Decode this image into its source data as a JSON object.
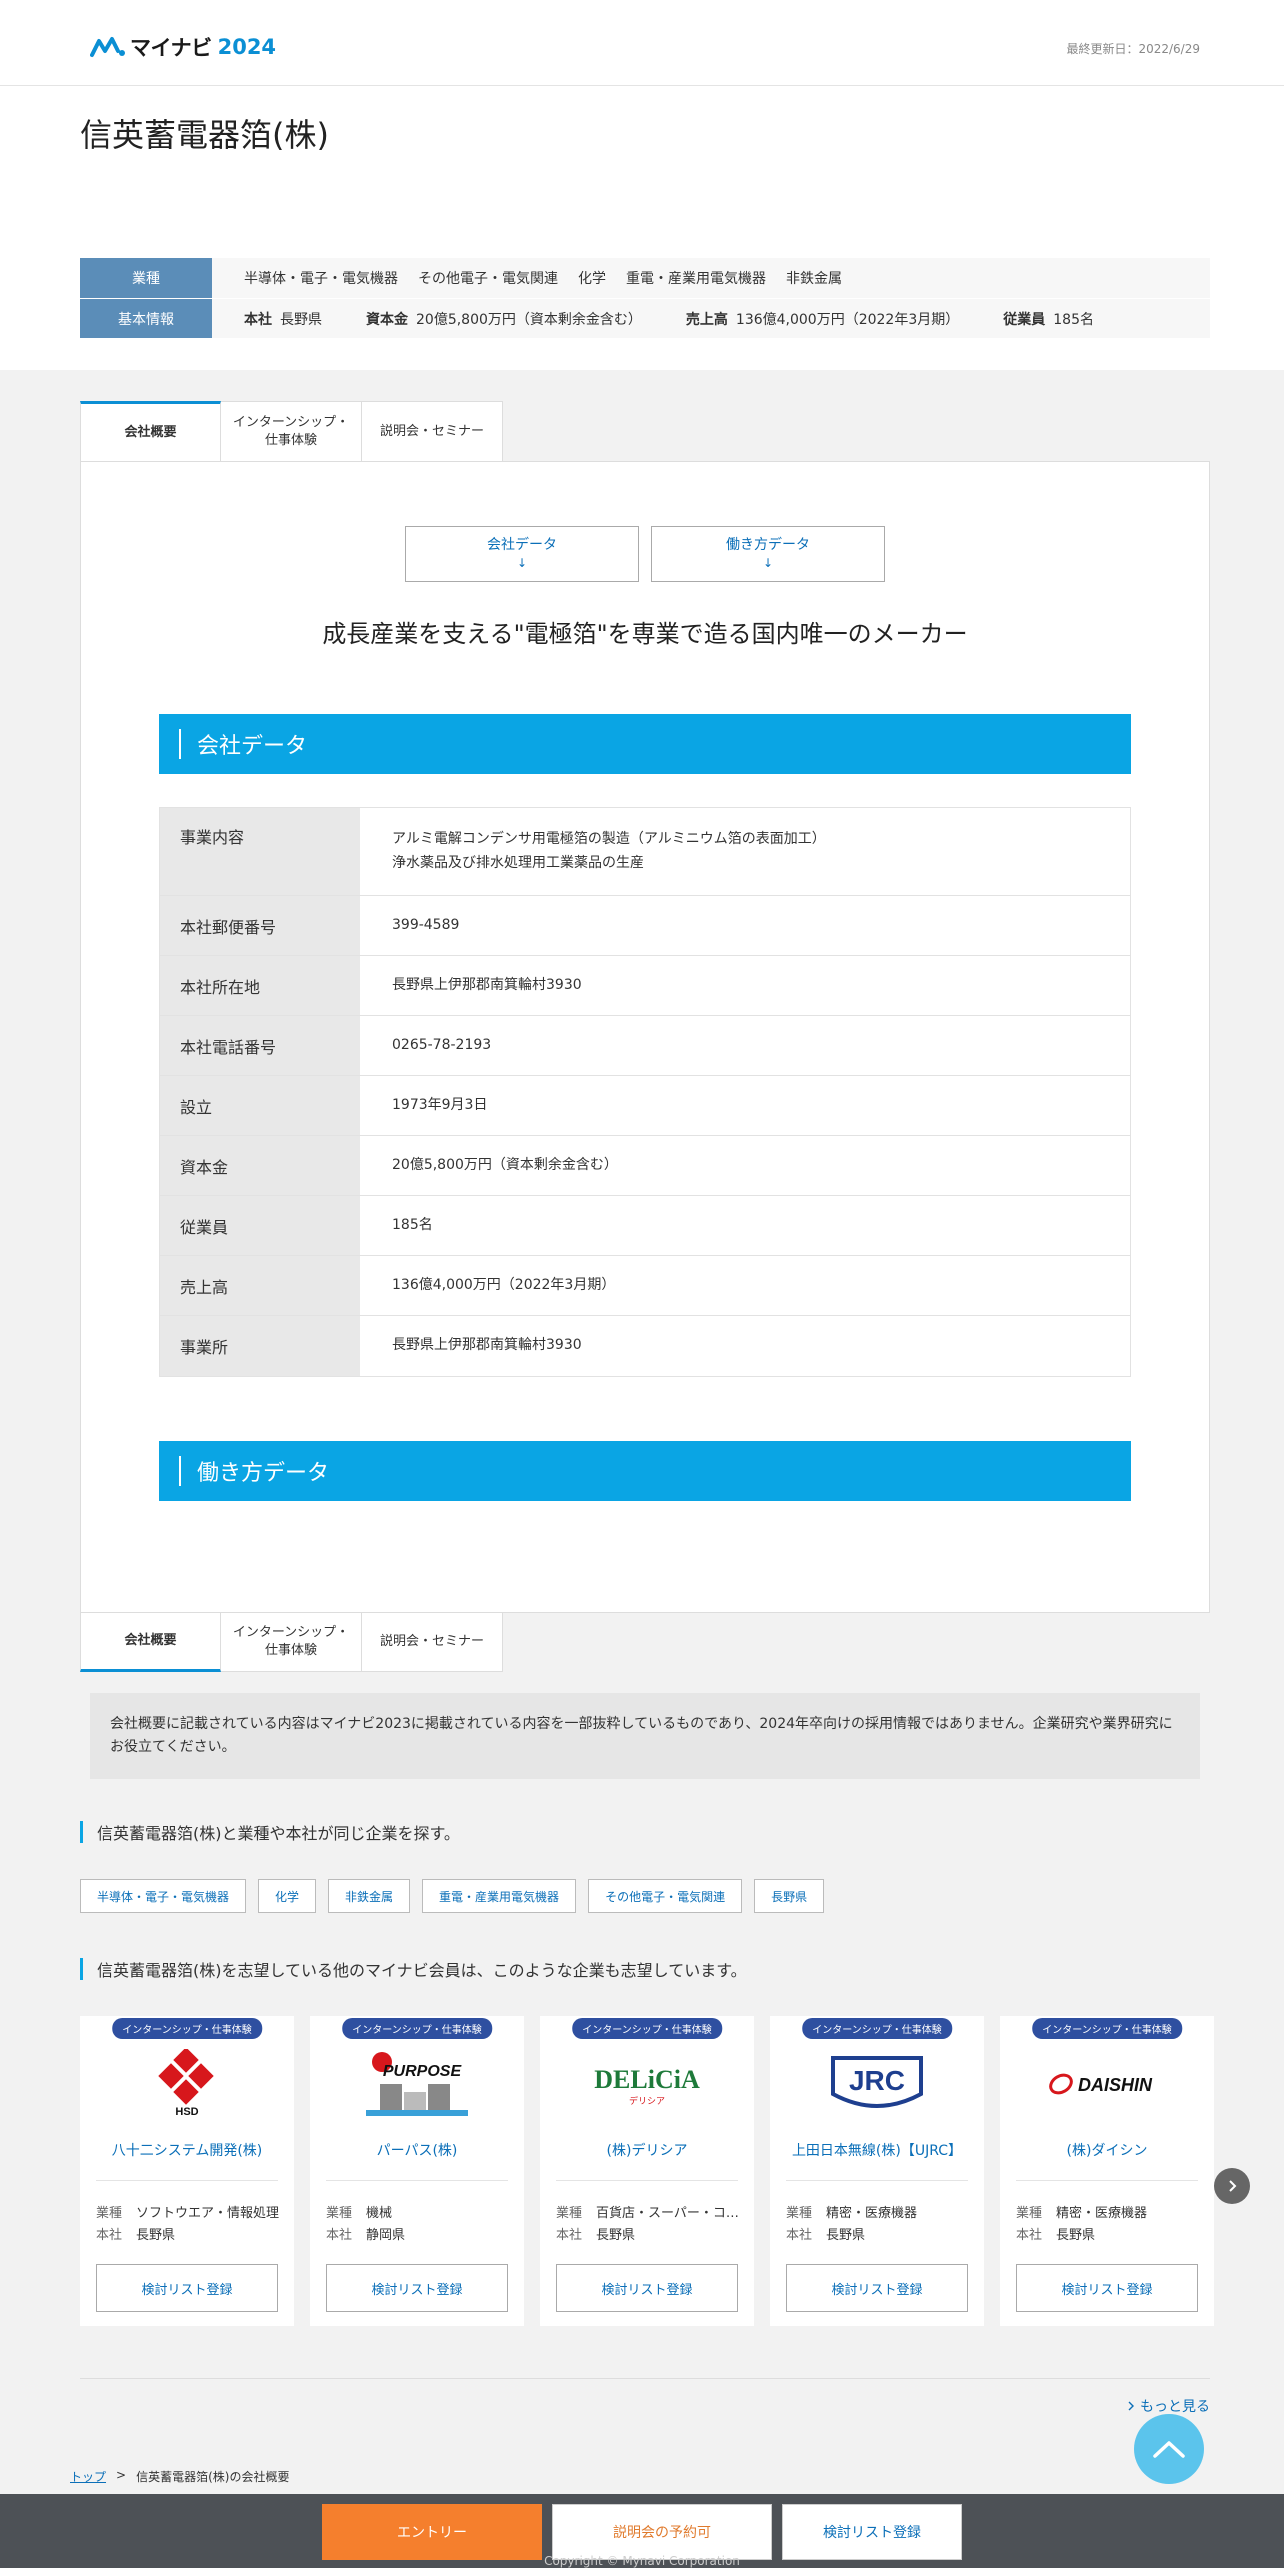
{
  "header": {
    "brand": "マイナビ",
    "year": "2024",
    "updated": "最終更新日：2022/6/29"
  },
  "company": {
    "name": "信英蓄電器箔(株)"
  },
  "info": {
    "industry_label": "業種",
    "industries": [
      "半導体・電子・電気機器",
      "その他電子・電気関連",
      "化学",
      "重電・産業用電気機器",
      "非鉄金属"
    ],
    "basic_label": "基本情報",
    "basic": [
      {
        "k": "本社",
        "v": "長野県"
      },
      {
        "k": "資本金",
        "v": "20億5,800万円（資本剰余金含む）"
      },
      {
        "k": "売上高",
        "v": "136億4,000万円（2022年3月期）"
      },
      {
        "k": "従業員",
        "v": "185名"
      }
    ]
  },
  "tabs": [
    "会社概要",
    "インターンシップ・\n仕事体験",
    "説明会・セミナー"
  ],
  "jump": {
    "company_data": "会社データ",
    "work_data": "働き方データ",
    "arrow": "↓"
  },
  "catchcopy": "成長産業を支える\"電極箔\"を専業で造る国内唯一のメーカー",
  "section_company": "会社データ",
  "section_work": "働き方データ",
  "company_data": [
    {
      "label": "事業内容",
      "lines": [
        "アルミ電解コンデンサ用電極箔の製造（アルミニウム箔の表面加工）",
        "浄水薬品及び排水処理用工業薬品の生産"
      ]
    },
    {
      "label": "本社郵便番号",
      "lines": [
        "399-4589"
      ]
    },
    {
      "label": "本社所在地",
      "lines": [
        "長野県上伊那郡南箕輪村3930"
      ]
    },
    {
      "label": "本社電話番号",
      "lines": [
        "0265-78-2193"
      ]
    },
    {
      "label": "設立",
      "lines": [
        "1973年9月3日"
      ]
    },
    {
      "label": "資本金",
      "lines": [
        "20億5,800万円（資本剰余金含む）"
      ]
    },
    {
      "label": "従業員",
      "lines": [
        "185名"
      ]
    },
    {
      "label": "売上高",
      "lines": [
        "136億4,000万円（2022年3月期）"
      ]
    },
    {
      "label": "事業所",
      "lines": [
        "長野県上伊那郡南箕輪村3930"
      ]
    }
  ],
  "notice": "会社概要に記載されている内容はマイナビ2023に掲載されている内容を一部抜粋しているものであり、2024年卒向けの採用情報ではありません。企業研究や業界研究にお役立てください。",
  "similar_title": "信英蓄電器箔(株)と業種や本社が同じ企業を探す。",
  "tags": [
    "半導体・電子・電気機器",
    "化学",
    "非鉄金属",
    "重電・産業用電気機器",
    "その他電子・電気関連",
    "長野県"
  ],
  "others_title": "信英蓄電器箔(株)を志望している他のマイナビ会員は、このような企業も志望しています。",
  "cards": [
    {
      "badge": "インターンシップ・仕事体験",
      "name": "八十二システム開発(株)",
      "industry": "ソフトウエア・情報処理",
      "hq": "長野県",
      "logo": "HSD",
      "logo_icon": "hsd-logo"
    },
    {
      "badge": "インターンシップ・仕事体験",
      "name": "パーパス(株)",
      "industry": "機械",
      "hq": "静岡県",
      "logo": "PURPOSE",
      "logo_icon": "purpose-logo"
    },
    {
      "badge": "インターンシップ・仕事体験",
      "name": "(株)デリシア",
      "industry": "百貨店・スーパー・コンビニ",
      "hq": "長野県",
      "logo": "DELiCiA",
      "logo_sub": "デリシア",
      "logo_icon": "delicia-logo"
    },
    {
      "badge": "インターンシップ・仕事体験",
      "name": "上田日本無線(株)【UJRC】",
      "industry": "精密・医療機器",
      "hq": "長野県",
      "logo": "JRC",
      "logo_icon": "jrc-logo"
    },
    {
      "badge": "インターンシップ・仕事体験",
      "name": "(株)ダイシン",
      "industry": "精密・医療機器",
      "hq": "長野県",
      "logo": "DAISHIN",
      "logo_icon": "daishin-logo"
    }
  ],
  "card_labels": {
    "industry": "業種",
    "hq": "本社",
    "register": "検討リスト登録"
  },
  "more": "もっと見る",
  "breadcrumb": {
    "top": "トップ",
    "sep": ">",
    "current": "信英蓄電器箔(株)の会社概要"
  },
  "footer": {
    "entry": "エントリー",
    "seminar": "説明会の予約可",
    "list": "検討リスト登録",
    "copyright": "Copyright © Mynavi Corporation"
  },
  "colors": {
    "accent": "#0aa5e4",
    "entry": "#f57f2d",
    "label": "#5b8db8"
  }
}
